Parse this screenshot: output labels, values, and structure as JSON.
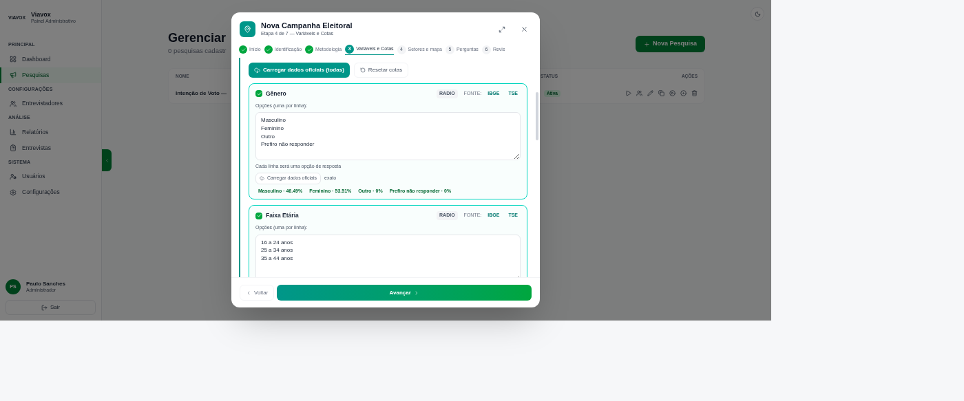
{
  "sidebar": {
    "brand": {
      "logo_text": "VIAVOX",
      "name": "Viavox",
      "subtitle": "Painel Administrativo"
    },
    "sections": [
      {
        "title": "PRINCIPAL",
        "items": [
          {
            "label": "Dashboard",
            "selected": false
          },
          {
            "label": "Pesquisas",
            "selected": true
          }
        ]
      },
      {
        "title": "CONFIGURAÇÕES",
        "items": [
          {
            "label": "Entrevistadores",
            "selected": false
          }
        ]
      },
      {
        "title": "ANÁLISE",
        "items": [
          {
            "label": "Relatórios",
            "selected": false
          },
          {
            "label": "Entrevistas",
            "selected": false
          }
        ]
      },
      {
        "title": "SISTEMA",
        "items": [
          {
            "label": "Usuários",
            "selected": false
          },
          {
            "label": "Configurações",
            "selected": false
          }
        ]
      }
    ],
    "user": {
      "initials": "PS",
      "name": "Paulo Sanches",
      "role": "Administrador"
    },
    "logout": "Sair"
  },
  "page": {
    "title": "Gerenciar",
    "subtitle": "0 pesquisas cadastr",
    "new_button": "Nova Pesquisa",
    "table": {
      "columns": [
        "NOME",
        "STATUS",
        "AÇÕES"
      ],
      "rows": [
        {
          "name": "Intenção de Voto —",
          "status": "Ativa"
        }
      ]
    }
  },
  "modal": {
    "title": "Nova Campanha Eleitoral",
    "subtitle": "Etapa 4 de 7 — Variáveis e Cotas",
    "steps": [
      {
        "label": "Início",
        "done": true,
        "selected": false
      },
      {
        "label": "Identificação",
        "done": true,
        "selected": false
      },
      {
        "label": "Metodologia",
        "done": true,
        "selected": false
      },
      {
        "number": "3",
        "label": "Variáveis e Cotas",
        "done": false,
        "selected": true
      },
      {
        "number": "4",
        "label": "Setores e mapa",
        "done": false,
        "selected": false
      },
      {
        "number": "5",
        "label": "Perguntas",
        "done": false,
        "selected": false
      },
      {
        "number": "6",
        "label": "Revis",
        "done": false,
        "selected": false
      }
    ],
    "load_all_button": "Carregar dados oficiais (todas)",
    "reset_button": "Resetar cotas",
    "variables": [
      {
        "name": "Gênero",
        "checked": true,
        "type_tag": "RADIO",
        "source_label": "FONTE:",
        "sources": [
          "IBGE",
          "TSE"
        ],
        "options_label": "Opções (uma por linha):",
        "options": [
          "Masculino",
          "Feminino",
          "Outro",
          "Prefiro não responder"
        ],
        "hint": "Cada linha será uma opção de resposta",
        "load_button": "Carregar dados oficiais",
        "mode": "exato",
        "quotas": [
          "Masculino · 46.49%",
          "Feminino · 53.51%",
          "Outro · 0%",
          "Prefiro não responder · 0%"
        ]
      },
      {
        "name": "Faixa Etária",
        "checked": true,
        "type_tag": "RADIO",
        "source_label": "FONTE:",
        "sources": [
          "IBGE",
          "TSE"
        ],
        "options_label": "Opções (uma por linha):",
        "options": [
          "16 a 24 anos",
          "25 a 34 anos",
          "35 a 44 anos"
        ]
      }
    ],
    "back_button": "Voltar",
    "next_button": "Avançar"
  }
}
